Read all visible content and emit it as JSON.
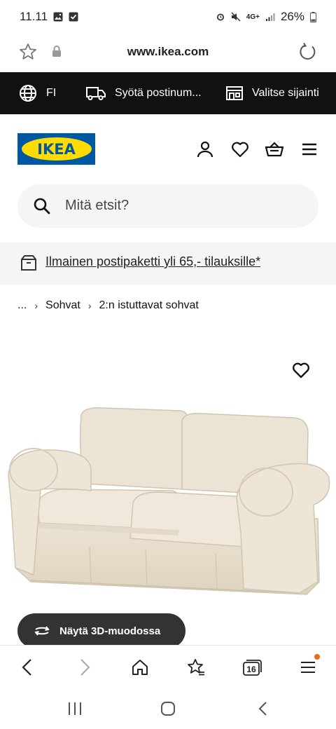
{
  "status_bar": {
    "time": "11.11",
    "network": "4G+",
    "battery": "26%"
  },
  "browser": {
    "url": "www.ikea.com",
    "tab_count": "16"
  },
  "top_bar": {
    "language": "FI",
    "postal": "Syötä postinum...",
    "store": "Valitse sijainti"
  },
  "header": {
    "logo_text": "IKEA"
  },
  "search": {
    "placeholder": "Mitä etsit?"
  },
  "promo": {
    "text": "Ilmainen postipaketti yli 65,- tilauksille*"
  },
  "breadcrumb": {
    "items": [
      "...",
      "Sohvat",
      "2:n istuttavat sohvat"
    ]
  },
  "product": {
    "view_3d_label": "Näytä 3D-muodossa"
  },
  "colors": {
    "ikea_blue": "#0058a3",
    "ikea_yellow": "#ffdb00",
    "notification_dot": "#f26522"
  }
}
